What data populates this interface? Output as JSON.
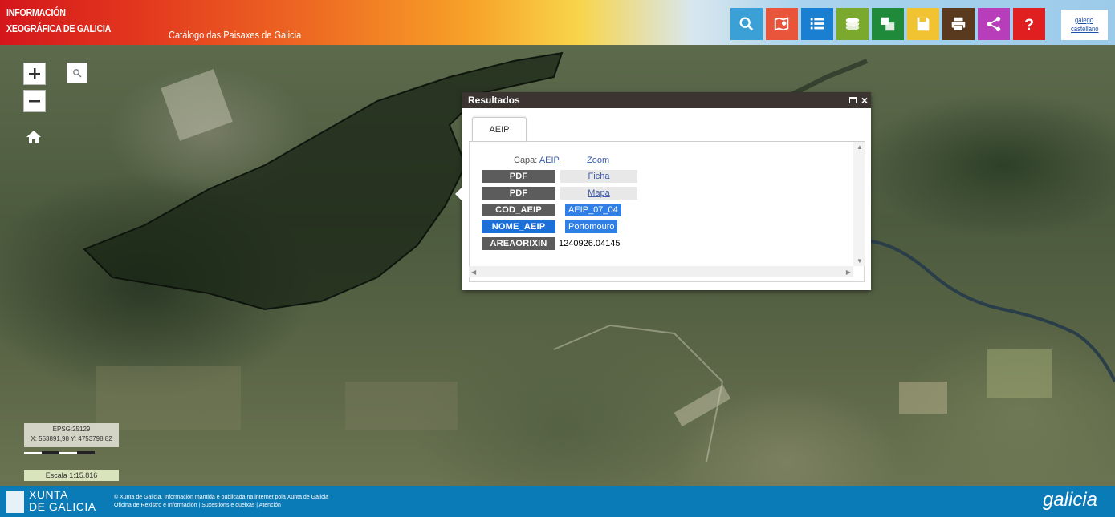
{
  "header": {
    "brand_line1": "INFORMACIÓN",
    "brand_line2": "XEOGRÁFICA DE GALICIA",
    "catalog_title": "Catálogo das Paisaxes de Galicia",
    "tools": [
      {
        "icon": "search-icon",
        "color": "#3aa0d6"
      },
      {
        "icon": "map-search-icon",
        "color": "#e8553a"
      },
      {
        "icon": "list-icon",
        "color": "#1a7fd0"
      },
      {
        "icon": "layers-icon",
        "color": "#7aa92e"
      },
      {
        "icon": "map-legend-icon",
        "color": "#1f8a3a"
      },
      {
        "icon": "save-icon",
        "color": "#f1c232"
      },
      {
        "icon": "print-icon",
        "color": "#5a3a1e"
      },
      {
        "icon": "share-icon",
        "color": "#b83dba"
      },
      {
        "icon": "help-icon",
        "color": "#e02020"
      }
    ],
    "lang_gl": "galego",
    "lang_es": "castellano"
  },
  "map": {
    "coords_line1": "EPSG:25129",
    "coords_line2": "X: 553891,98 Y: 4753798,82",
    "scale_text": "Escala 1:15.816"
  },
  "popup": {
    "title": "Resultados",
    "tab_label": "AEIP",
    "capa_label": "Capa:",
    "capa_value": "AEIP",
    "zoom_label": "Zoom",
    "rows": [
      {
        "label": "PDF",
        "value": "Ficha"
      },
      {
        "label": "PDF",
        "value": "Mapa"
      },
      {
        "label": "COD_AEIP",
        "value": "AEIP_07_04"
      },
      {
        "label": "NOME_AEIP",
        "value": "Portomouro"
      },
      {
        "label": "AREAORIXIN",
        "value": "1240926.04145"
      }
    ]
  },
  "footer": {
    "xunta_line1": "XUNTA",
    "xunta_line2": "DE GALICIA",
    "legal_line1": "© Xunta de Galicia. Información mantida e publicada na internet pola Xunta de Galicia",
    "legal_line2": "Oficina de Rexistro e Información | Suxestións e queixas | Atención",
    "brand": "galicia"
  }
}
